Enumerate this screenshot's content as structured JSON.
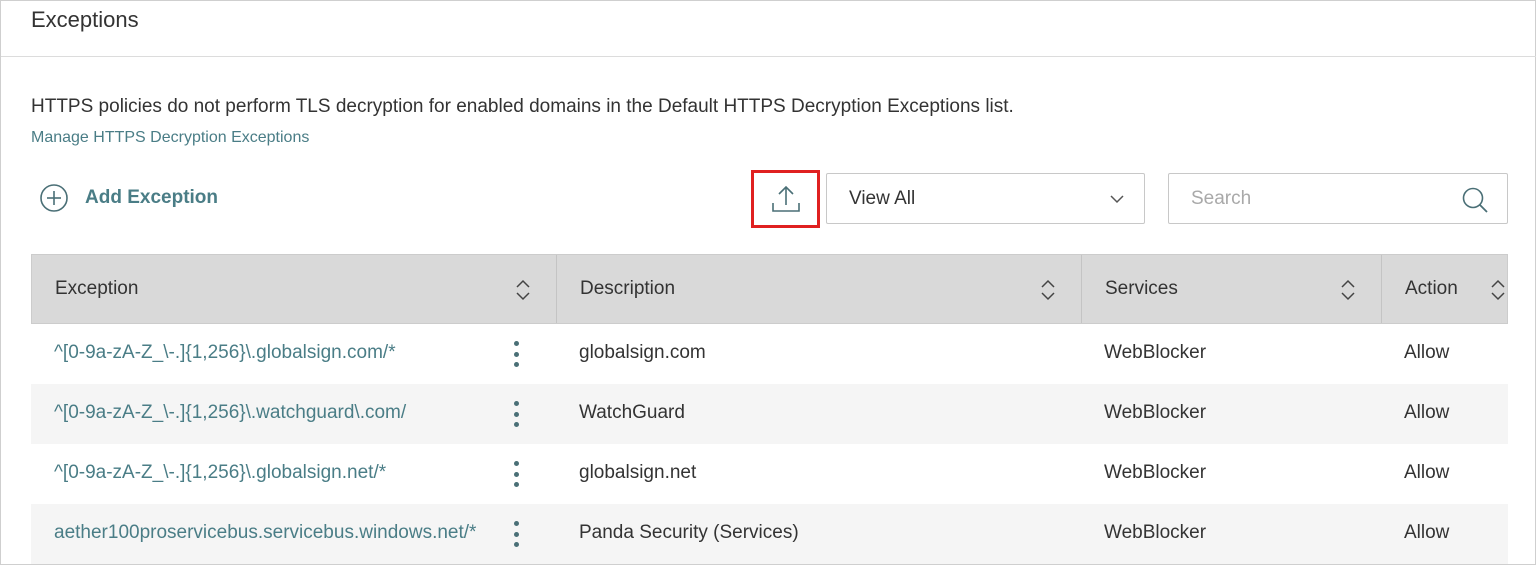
{
  "page": {
    "title": "Exceptions",
    "description": "HTTPS policies do not perform TLS decryption for enabled domains in the Default HTTPS Decryption Exceptions list.",
    "manage_link": "Manage HTTPS Decryption Exceptions"
  },
  "toolbar": {
    "add_label": "Add Exception",
    "add_icon": "plus-circle-icon",
    "export_icon": "upload-icon",
    "filter_value": "View All",
    "search_placeholder": "Search",
    "search_value": ""
  },
  "table": {
    "columns": [
      {
        "label": "Exception"
      },
      {
        "label": "Description"
      },
      {
        "label": "Services"
      },
      {
        "label": "Action"
      }
    ],
    "rows": [
      {
        "exception": "^[0-9a-zA-Z_\\-.]{1,256}\\.globalsign.com/*",
        "description": "globalsign.com",
        "services": "WebBlocker",
        "action": "Allow"
      },
      {
        "exception": "^[0-9a-zA-Z_\\-.]{1,256}\\.watchguard\\.com/",
        "description": "WatchGuard",
        "services": "WebBlocker",
        "action": "Allow"
      },
      {
        "exception": "^[0-9a-zA-Z_\\-.]{1,256}\\.globalsign.net/*",
        "description": "globalsign.net",
        "services": "WebBlocker",
        "action": "Allow"
      },
      {
        "exception": "aether100proservicebus.servicebus.windows.net/*",
        "description": "Panda Security (Services)",
        "services": "WebBlocker",
        "action": "Allow"
      }
    ]
  },
  "colors": {
    "link": "#4a7d86",
    "header_bg": "#d9d9d9",
    "row_alt_bg": "#f5f5f5",
    "highlight_border": "#e02020"
  }
}
